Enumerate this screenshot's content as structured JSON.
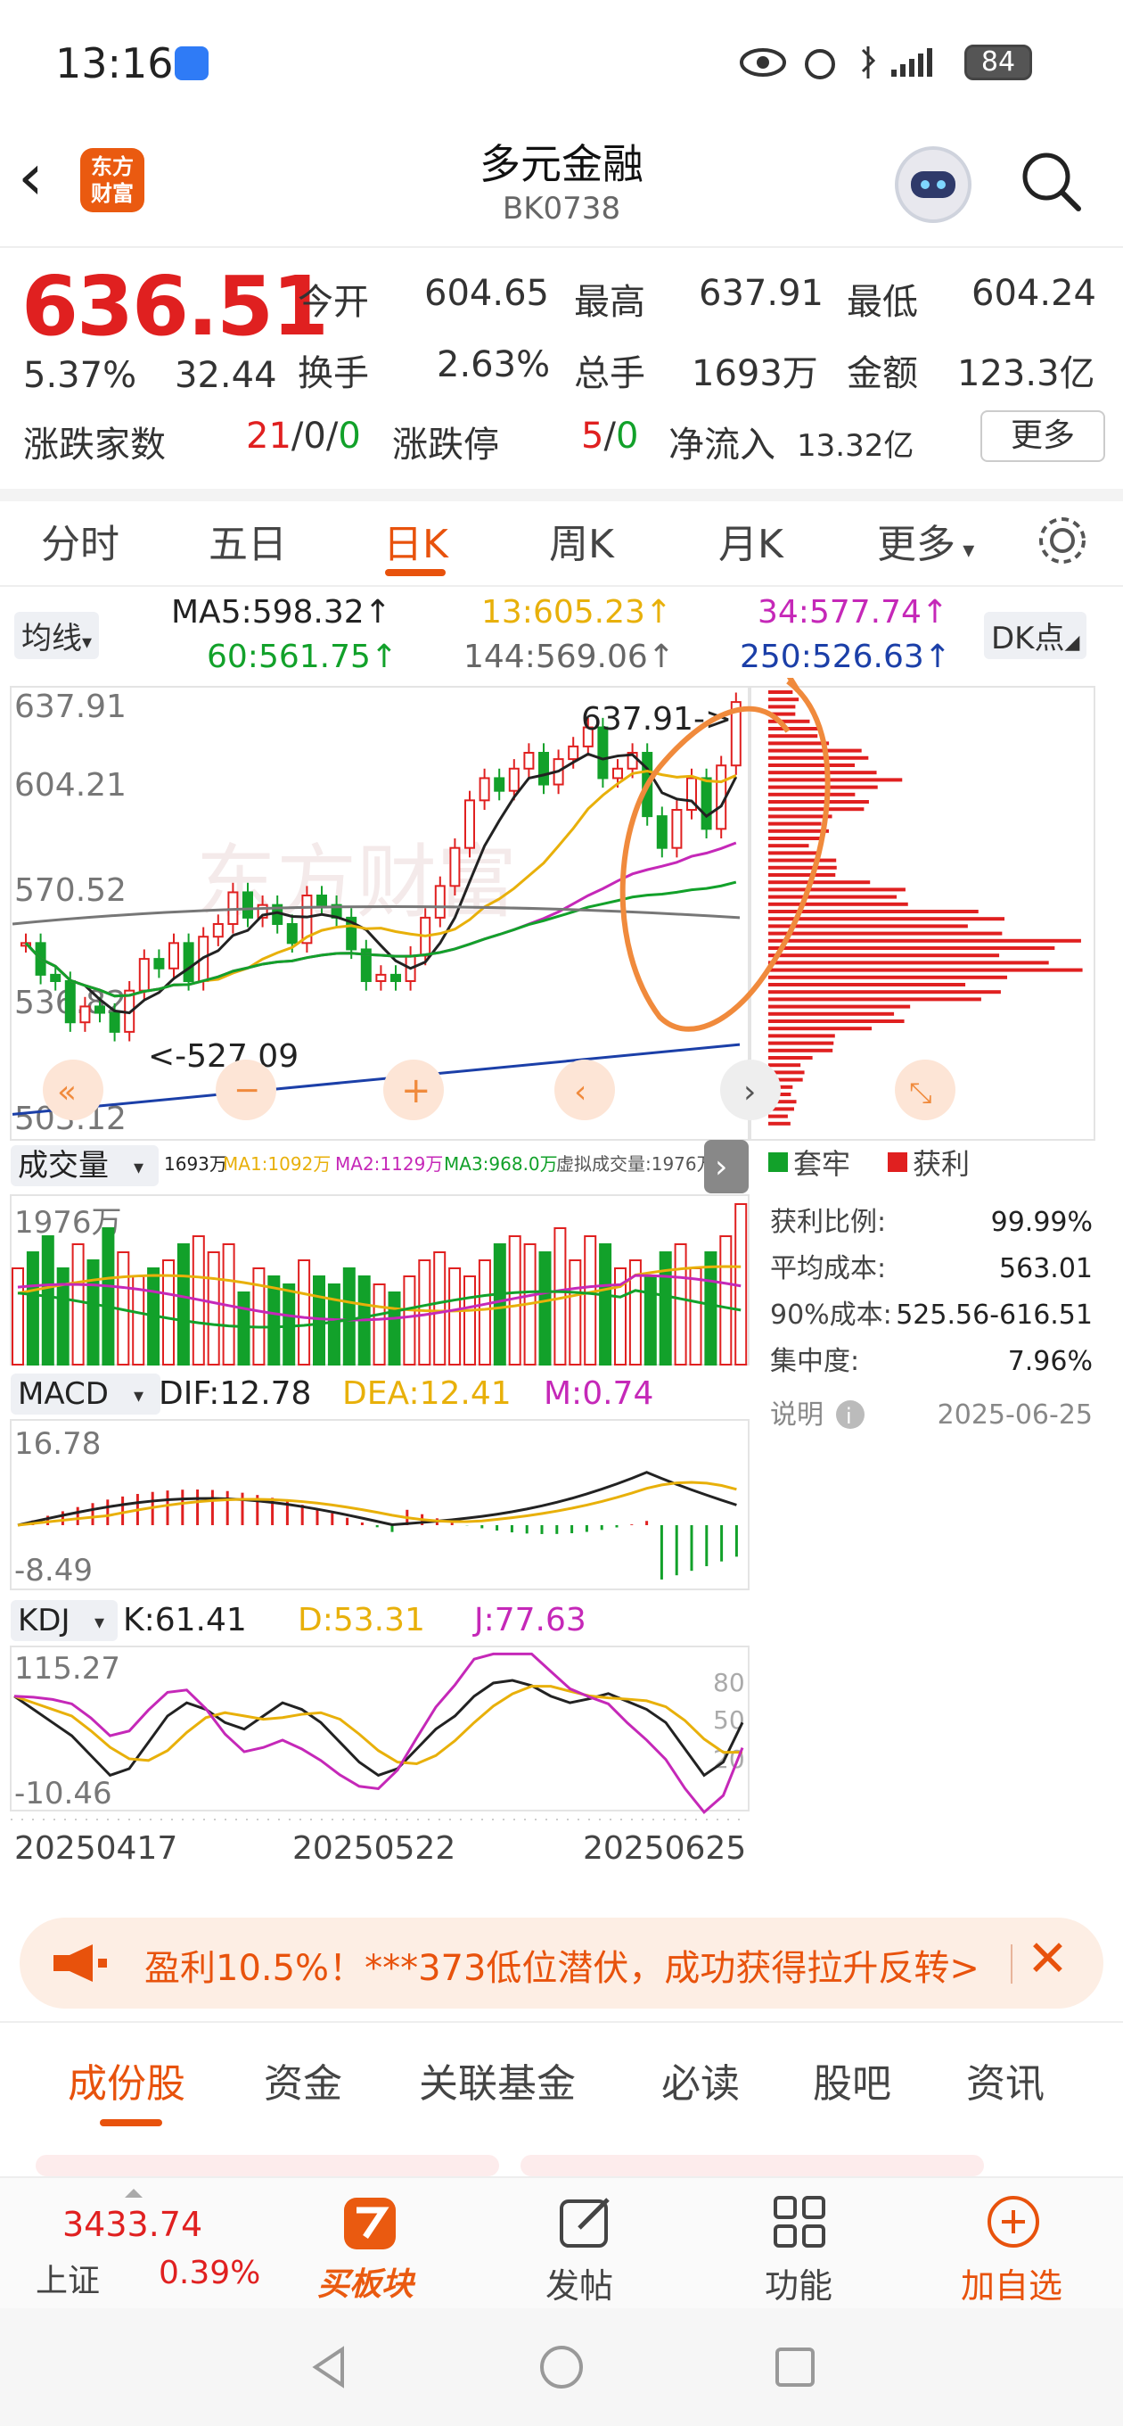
{
  "status": {
    "time": "13:16",
    "battery": "84"
  },
  "header": {
    "logo_line1": "东方",
    "logo_line2": "财富",
    "title": "多元金融",
    "code": "BK0738"
  },
  "quote": {
    "price": "636.51",
    "change_pct": "5.37%",
    "change_val": "32.44",
    "open_label": "今开",
    "open": "604.65",
    "high_label": "最高",
    "high": "637.91",
    "low_label": "最低",
    "low": "604.24",
    "turnover_label": "换手",
    "turnover": "2.63%",
    "volume_label": "总手",
    "volume": "1693万",
    "amount_label": "金额",
    "amount": "123.3亿",
    "breadth_label": "涨跌家数",
    "breadth_up": "21",
    "breadth_flat": "0",
    "breadth_down": "0",
    "limit_label": "涨跌停",
    "limit_up": "5",
    "limit_down": "0",
    "netflow_label": "净流入",
    "netflow": "13.32亿",
    "more": "更多"
  },
  "tabs": [
    "分时",
    "五日",
    "日K",
    "周K",
    "月K",
    "更多"
  ],
  "ma": {
    "selector": "均线",
    "ma5": "MA5:598.32",
    "ma13": "13:605.23",
    "ma34": "34:577.74",
    "ma60": "60:561.75",
    "ma144": "144:569.06",
    "ma250": "250:526.63",
    "dk": "DK点"
  },
  "kline": {
    "axis_labels": [
      "637.91",
      "604.21",
      "570.52",
      "536.82",
      "503.12"
    ],
    "high_note": "637.91->",
    "low_note": "<-527.09",
    "watermark": "东方财富"
  },
  "volume": {
    "selector": "成交量",
    "legend": "1693万",
    "ma1": "MA1:1092万",
    "ma2": "MA2:1129万",
    "ma3": "MA3:968.0万",
    "virtual": "虚拟成交量:1976万",
    "max": "1976万"
  },
  "macd": {
    "selector": "MACD",
    "dif": "DIF:12.78",
    "dea": "DEA:12.41",
    "m": "M:0.74",
    "top": "16.78",
    "bottom": "-8.49"
  },
  "kdj": {
    "selector": "KDJ",
    "k": "K:61.41",
    "d": "D:53.31",
    "j": "J:77.63",
    "top": "115.27",
    "bottom": "-10.46",
    "levels": [
      "80",
      "50",
      "20"
    ]
  },
  "dates": [
    "20250417",
    "20250522",
    "20250625"
  ],
  "chips": {
    "legend_trap": "套牢",
    "legend_profit": "获利",
    "rows": [
      {
        "label": "获利比例:",
        "value": "99.99%"
      },
      {
        "label": "平均成本:",
        "value": "563.01"
      },
      {
        "label": "90%成本:",
        "value": "525.56-616.51"
      },
      {
        "label": "集中度:",
        "value": "7.96%"
      }
    ],
    "note_label": "说明",
    "date": "2025-06-25"
  },
  "banner": {
    "text": "盈利10.5%！***373低位潜伏，成功获得拉升反转>"
  },
  "subtabs": [
    "成份股",
    "资金",
    "关联基金",
    "必读",
    "股吧",
    "资讯"
  ],
  "bottom": {
    "index_value": "3433.74",
    "index_name": "上证",
    "index_change": "0.39%",
    "buy_label": "买板块",
    "post_label": "发帖",
    "func_label": "功能",
    "watch_label": "加自选"
  },
  "colors": {
    "up": "#e02020",
    "down": "#12a12a",
    "accent": "#e8520c",
    "annotation": "#f08a3c"
  }
}
